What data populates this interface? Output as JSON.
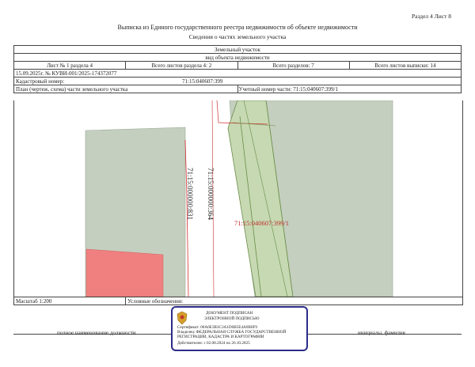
{
  "header": {
    "section_sheet": "Раздел 4   Лист 8",
    "title": "Выписка из Единого государственного реестра недвижимости об объекте недвижимости",
    "subtitle": "Сведения о частях земельного участка"
  },
  "form": {
    "object_label": "Земельный участок",
    "object_sub": "вид объекта недвижимости",
    "sheet_no": "Лист № 1 раздела 4",
    "total_sheets_section": "Всего листов раздела 4: 2",
    "total_sections": "Всего разделов: 7",
    "total_sheets_extract": "Всего листов выписки: 14",
    "date_number": "15.09.2025г. № КУВИ-001/2025-174372077",
    "cadastral_label": "Кадастровый номер:",
    "cadastral_value": "71:15:040607:399",
    "plan_label": "План (чертеж, схема) части земельного участка",
    "part_number": "Учетный номер части: 71:15:040607:399/1"
  },
  "map": {
    "road_label_1": "71:15:000000:831",
    "road_label_2": "71:15:000000:364",
    "parcel_label": "71:15:040607:399/1",
    "colors": {
      "grey_parcel": "#c4cfbf",
      "part": "#c6d9b2",
      "red_building": "#f08080",
      "outline": "#6b8c4a",
      "red_line": "#d03030"
    }
  },
  "footer": {
    "scale": "Масштаб 1:200",
    "legend": "Условные обозначения:",
    "position_label": "полное наименование должности",
    "signature_label": "инициалы, фамилия"
  },
  "stamp": {
    "line1": "ДОКУМЕНТ ПОДПИСАН",
    "line2": "ЭЛЕКТРОННОЙ ПОДПИСЬЮ",
    "line3": "Сертификат: 00A6E3B3C3A1D0B5E4A0B0F9",
    "line4": "Владелец: ФЕДЕРАЛЬНАЯ СЛУЖБА ГОСУДАРСТВЕННОЙ",
    "line5": "РЕГИСТРАЦИИ, КАДАСТРА И КАРТОГРАФИИ",
    "line6": "Действителен: с 02.08.2024 по 26.10.2025"
  }
}
